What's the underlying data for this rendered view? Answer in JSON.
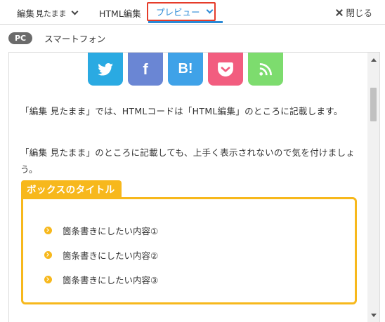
{
  "tabs": {
    "edit_label": "編集",
    "edit_mode": "見たまま",
    "html_label": "HTML編集",
    "preview_label": "プレビュー",
    "close_label": "閉じる"
  },
  "devices": {
    "pc": "PC",
    "smartphone": "スマートフォン"
  },
  "share": {
    "twitter": "twitter-icon",
    "facebook": "f",
    "hatena": "B!",
    "pocket": "pocket-icon",
    "rss": "rss-icon"
  },
  "content": {
    "paragraph1": "「編集 見たまま」では、HTMLコードは「HTML編集」のところに記載します。",
    "paragraph2": "「編集 見たまま」のところに記載しても、上手く表示されないので気を付けましょう。",
    "box_title": "ボックスのタイトル",
    "list": [
      "箇条書きにしたい内容①",
      "箇条書きにしたい内容②",
      "箇条書きにしたい内容③"
    ]
  },
  "colors": {
    "accent": "#2b8ad6",
    "highlight_border": "#e53c2a",
    "box": "#f7b81c"
  }
}
